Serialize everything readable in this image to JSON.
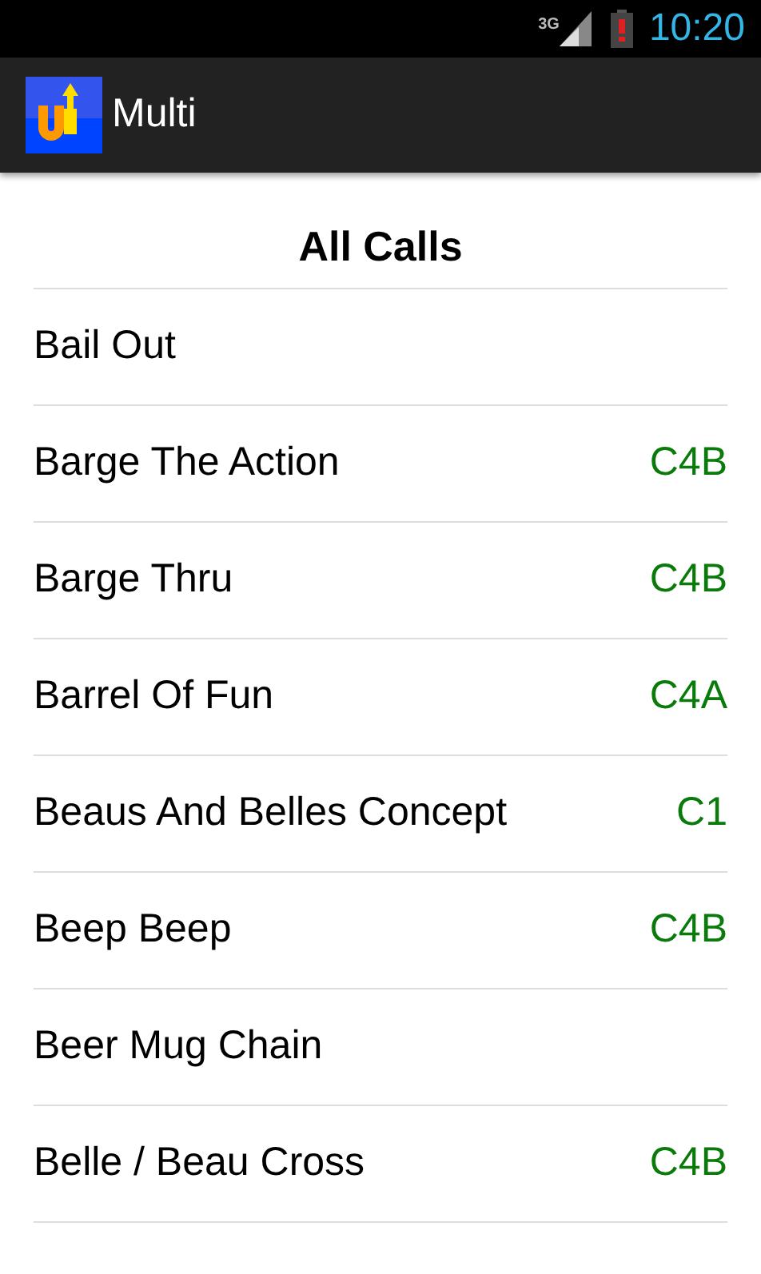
{
  "status_bar": {
    "network": "3G",
    "time": "10:20"
  },
  "app_bar": {
    "title": "Multi"
  },
  "list": {
    "title": "All Calls",
    "items": [
      {
        "name": "Bail Out"
      },
      {
        "name": "Barge The Action",
        "level_code": "C4B"
      },
      {
        "name": "Barge Thru",
        "level_code": "C4B"
      },
      {
        "name": "Barrel Of Fun",
        "level_code": "C4A"
      },
      {
        "name": "Beaus And Belles Concept",
        "level_code": "C1"
      },
      {
        "name": "Beep Beep",
        "level_code": "C4B"
      },
      {
        "name": "Beer Mug Chain"
      },
      {
        "name": "Belle / Beau Cross",
        "level_code": "C4B"
      }
    ]
  }
}
